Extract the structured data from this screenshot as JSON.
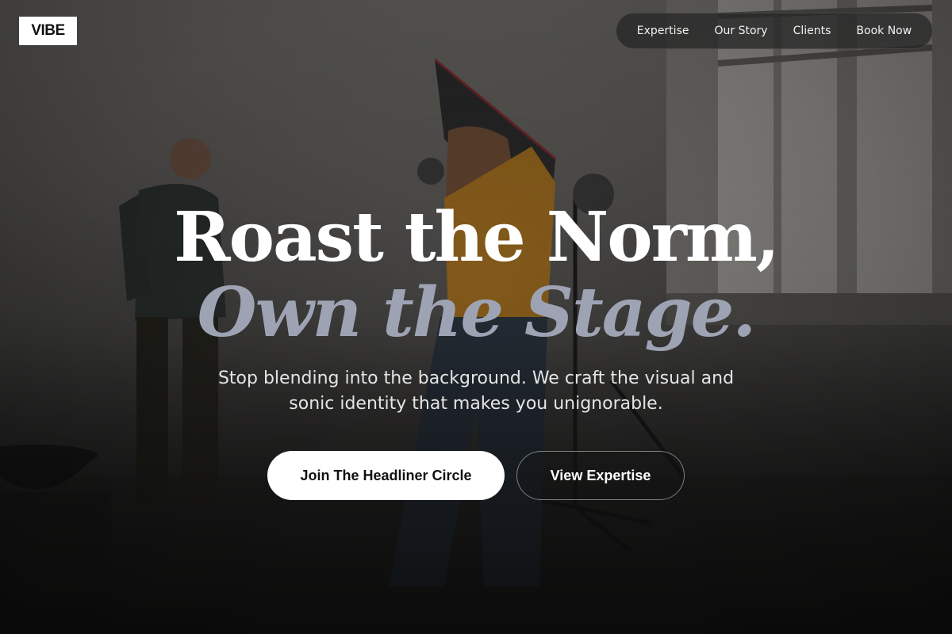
{
  "brand": {
    "logo_text": "VIBE"
  },
  "nav": {
    "items": [
      {
        "label": "Expertise"
      },
      {
        "label": "Our Story"
      },
      {
        "label": "Clients"
      },
      {
        "label": "Book Now"
      }
    ]
  },
  "hero": {
    "headline_line1": "Roast the Norm,",
    "headline_line2": "Own the Stage.",
    "subtitle": "Stop blending into the background. We craft the visual and sonic identity that makes you unignorable.",
    "primary_cta": "Join The Headliner Circle",
    "secondary_cta": "View Expertise"
  },
  "colors": {
    "accent_italic": "#9ea3b4",
    "primary_button_bg": "#ffffff",
    "nav_bg": "#282828"
  },
  "background": {
    "image": "photo-studio-scene",
    "description_icon": "photo-background"
  }
}
